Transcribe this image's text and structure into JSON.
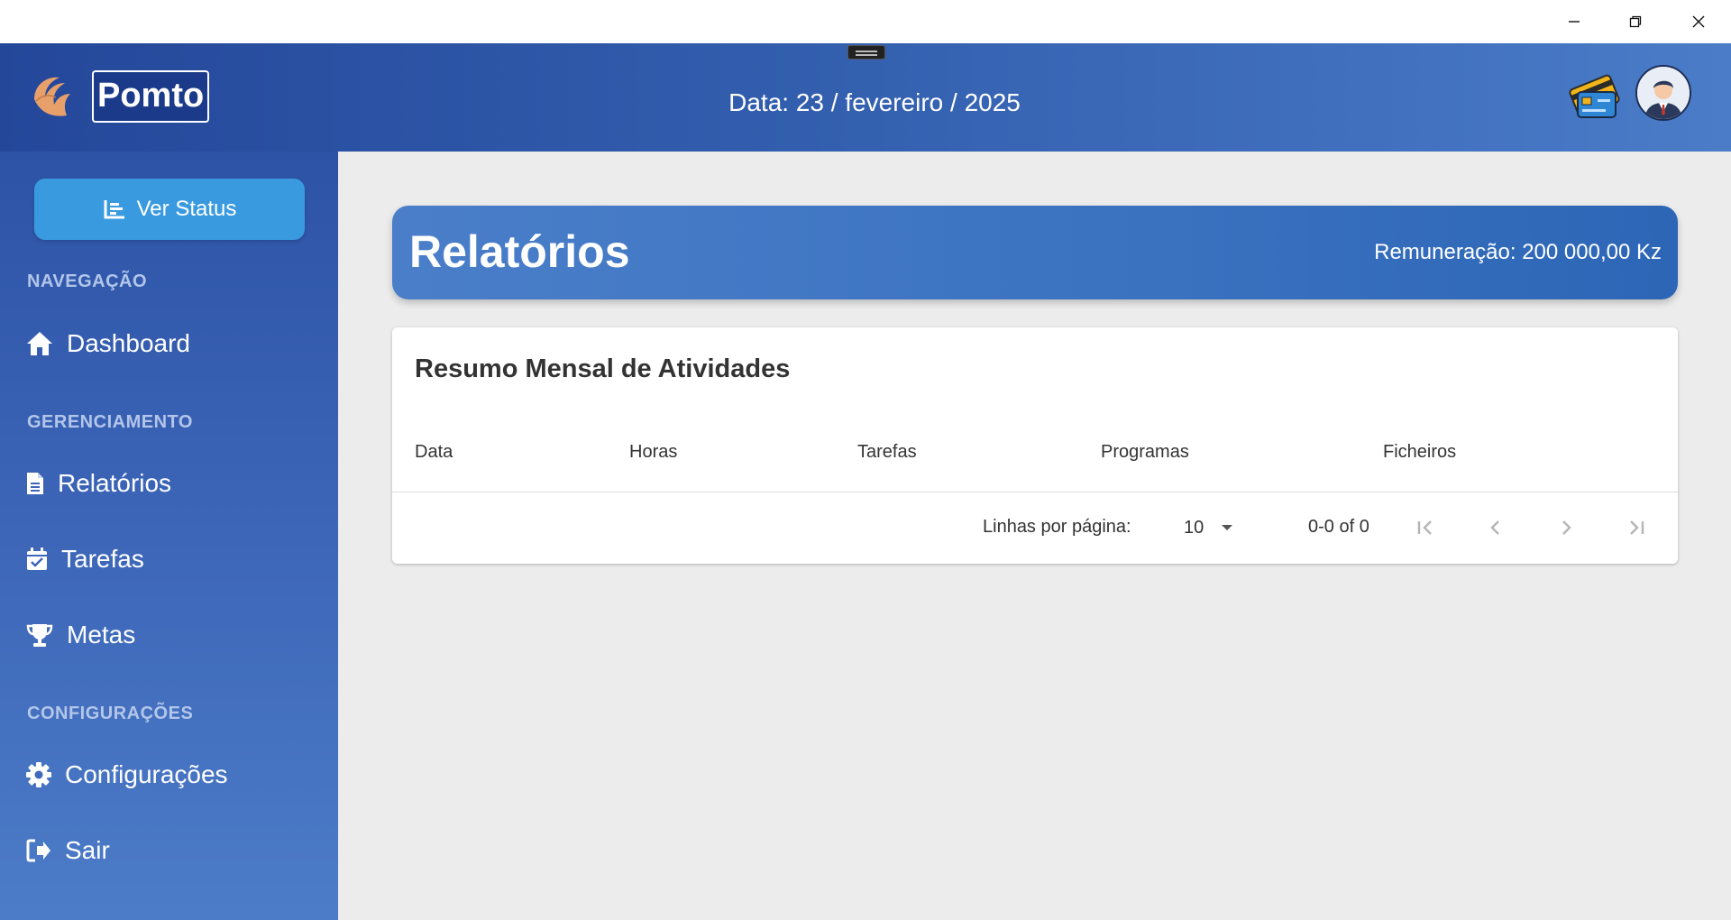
{
  "window": {
    "minimize_icon": "minimize-icon",
    "maximize_icon": "restore-icon",
    "close_icon": "close-icon"
  },
  "header": {
    "brand": "Pomto",
    "date": "Data: 23 / fevereiro / 2025",
    "logo_icon": "feather-logo-icon",
    "card_icon": "credit-card-icon",
    "avatar_icon": "user-avatar-icon"
  },
  "sidebar": {
    "status_button": "Ver Status",
    "sections": {
      "nav": "NAVEGAÇÃO",
      "manage": "GERENCIAMENTO",
      "config": "CONFIGURAÇÕES"
    },
    "items": [
      {
        "label": "Dashboard",
        "icon": "home-icon"
      },
      {
        "label": "Relatórios",
        "icon": "document-icon"
      },
      {
        "label": "Tarefas",
        "icon": "calendar-check-icon"
      },
      {
        "label": "Metas",
        "icon": "trophy-icon"
      },
      {
        "label": "Configurações",
        "icon": "gear-icon"
      },
      {
        "label": "Sair",
        "icon": "logout-icon"
      }
    ]
  },
  "main": {
    "title": "Relatórios",
    "remuneration": "Remuneração: 200 000,00 Kz",
    "table": {
      "title": "Resumo Mensal de Atividades",
      "columns": [
        "Data",
        "Horas",
        "Tarefas",
        "Programas",
        "Ficheiros"
      ],
      "rows": [],
      "pagination": {
        "rows_per_page_label": "Linhas por página:",
        "rows_per_page": "10",
        "range": "0-0 of 0"
      }
    }
  },
  "colors": {
    "header_gradient": [
      "#24479a",
      "#4a7cc8"
    ],
    "sidebar_gradient": [
      "#2d53a6",
      "#4c7cc8"
    ],
    "status_button": "#3a9ae0",
    "content_bg": "#ebeceb"
  }
}
